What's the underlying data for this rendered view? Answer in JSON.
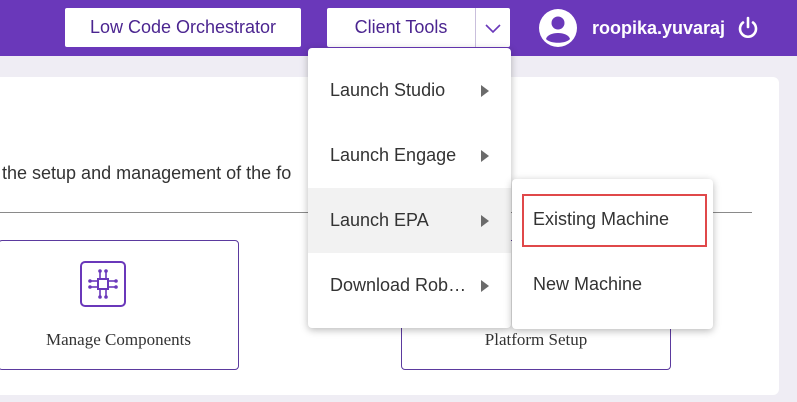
{
  "header": {
    "orchestrator_button": "Low Code Orchestrator",
    "client_tools_button": "Client Tools",
    "username": "roopika.yuvaraj"
  },
  "main": {
    "intro_text": "the setup and management of the fo",
    "tiles": [
      {
        "label": "Manage Components",
        "icon": "component-chip-icon"
      },
      {
        "label": "Platform Setup"
      }
    ]
  },
  "client_tools_menu": {
    "items": [
      {
        "label": "Launch Studio"
      },
      {
        "label": "Launch Engage"
      },
      {
        "label": "Launch EPA"
      },
      {
        "label": "Download Rob…"
      }
    ],
    "active_index": 2
  },
  "epa_submenu": {
    "items": [
      {
        "label": "Existing Machine"
      },
      {
        "label": "New Machine"
      }
    ],
    "highlighted_index": 0
  },
  "colors": {
    "brand_purple": "#6a38ba",
    "button_text": "#4b2590",
    "highlight_red": "#e0484a"
  }
}
